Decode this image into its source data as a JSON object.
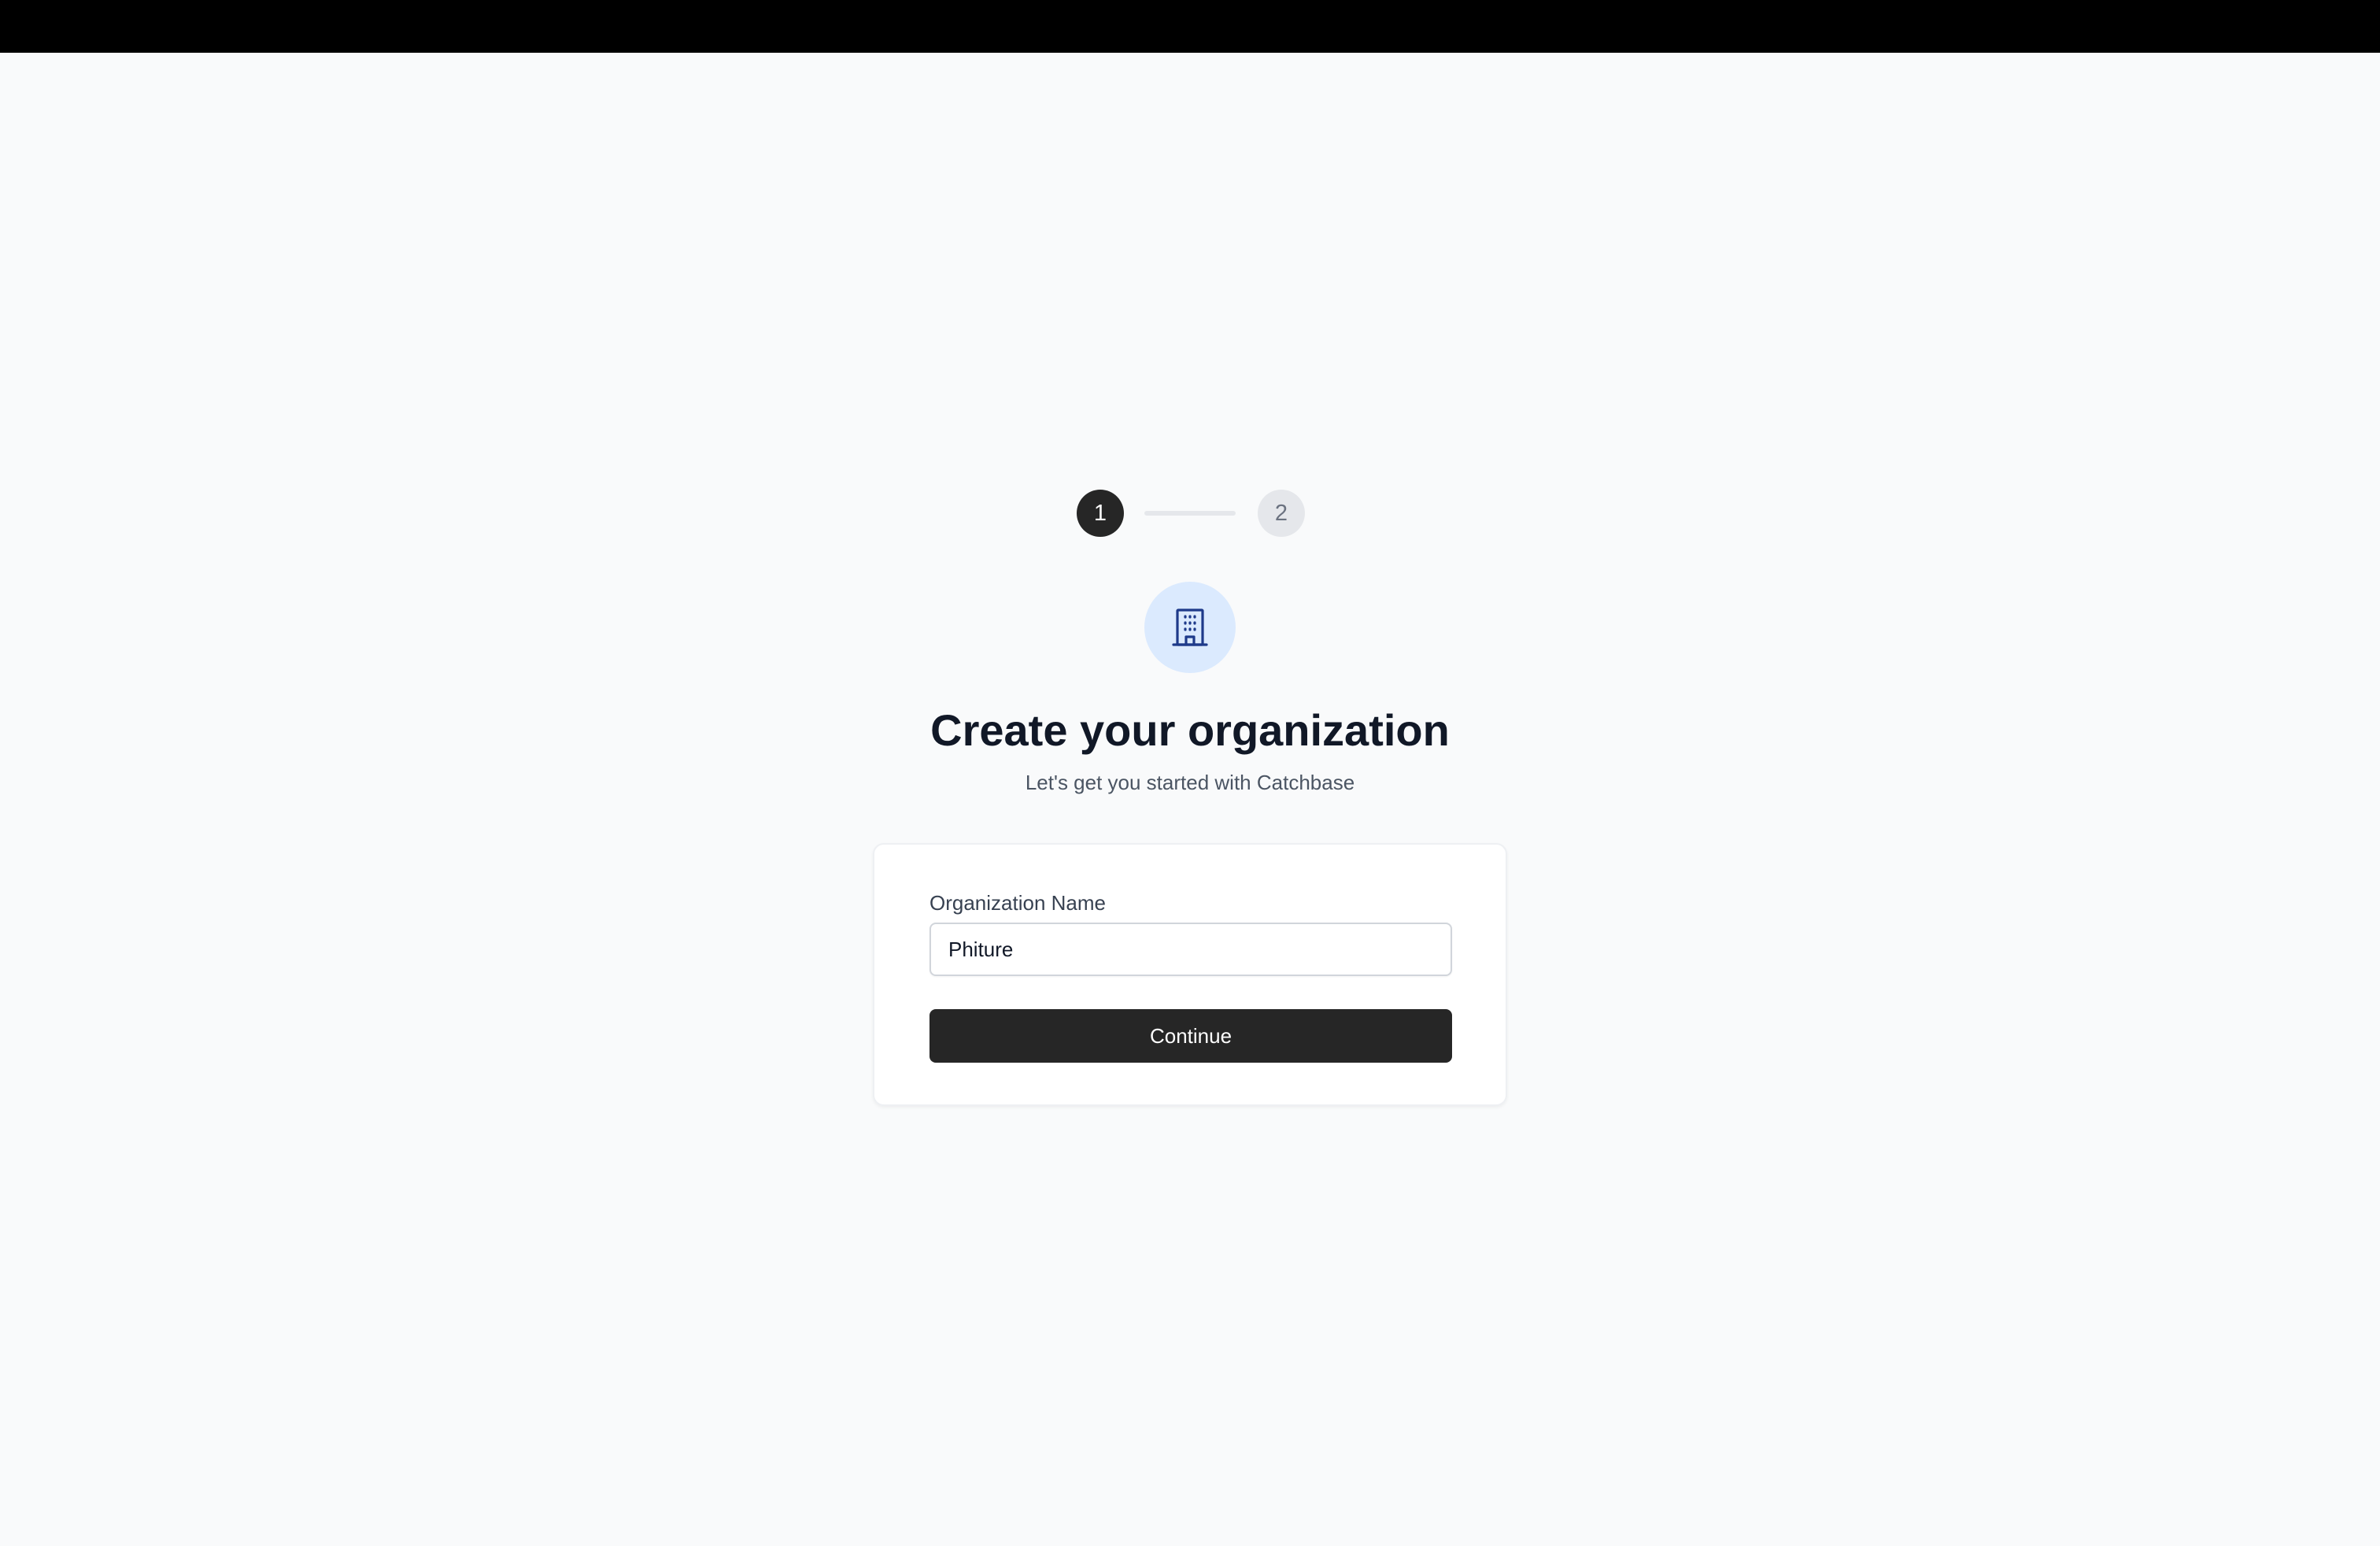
{
  "stepper": {
    "steps": [
      {
        "label": "1",
        "state": "active"
      },
      {
        "label": "2",
        "state": "inactive"
      }
    ]
  },
  "icon": {
    "name": "building-icon",
    "color": "#1e3a8a",
    "background": "#dbeafe"
  },
  "header": {
    "title": "Create your organization",
    "subtitle": "Let's get you started with Catchbase"
  },
  "form": {
    "org_name_label": "Organization Name",
    "org_name_value": "Phiture",
    "continue_label": "Continue"
  },
  "colors": {
    "primary": "#262626",
    "background": "#f9fafb"
  }
}
